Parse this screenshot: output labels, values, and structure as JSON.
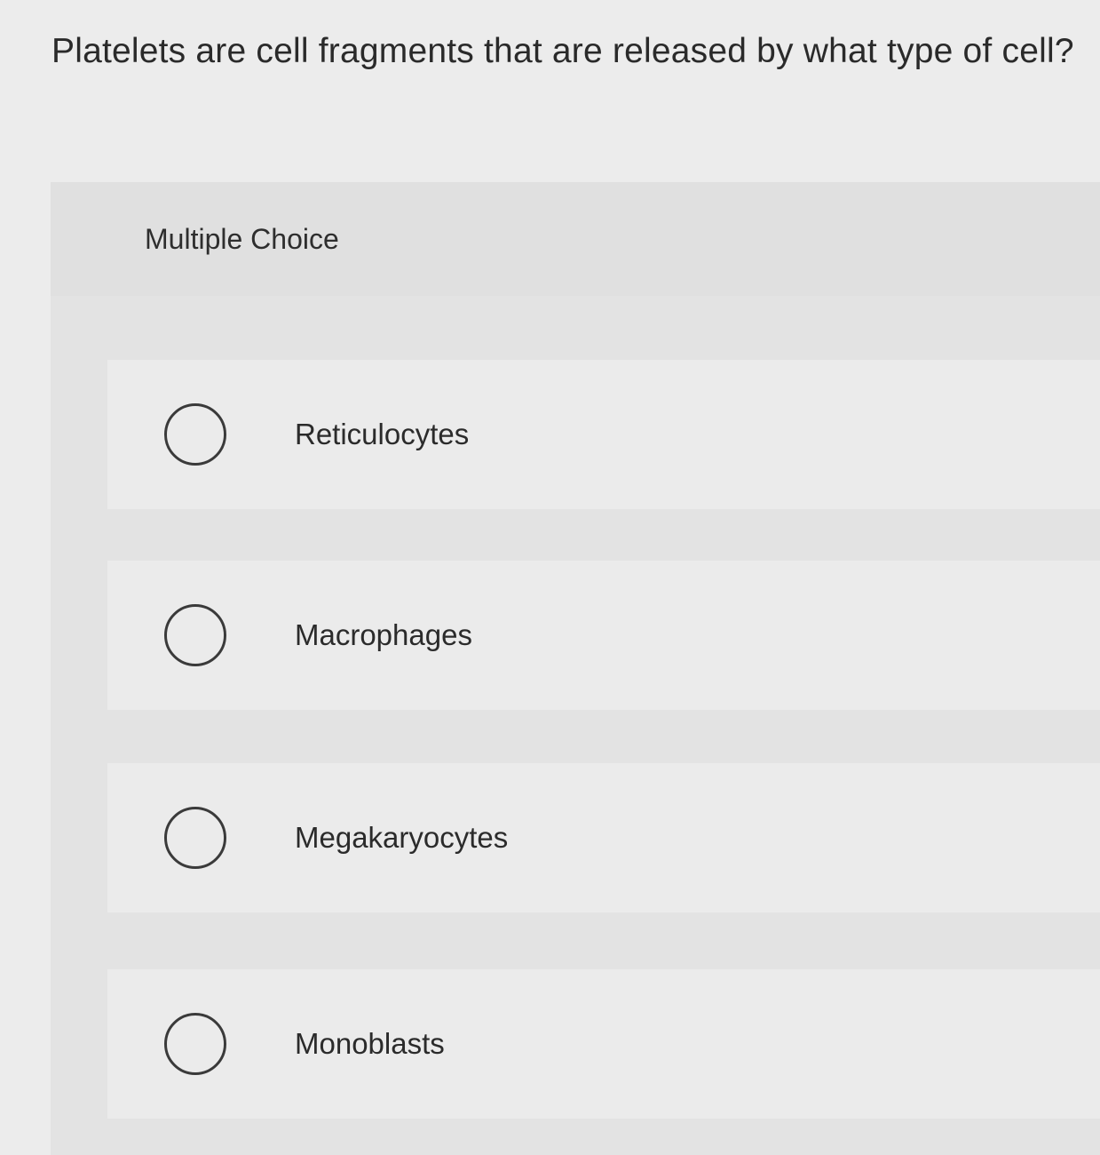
{
  "question": {
    "text": "Platelets are cell fragments that are released by what type of cell?"
  },
  "multiple_choice": {
    "label": "Multiple Choice",
    "options": [
      {
        "label": "Reticulocytes",
        "selected": false
      },
      {
        "label": "Macrophages",
        "selected": false
      },
      {
        "label": "Megakaryocytes",
        "selected": false
      },
      {
        "label": "Monoblasts",
        "selected": false
      }
    ]
  },
  "colors": {
    "page_background": "#ececec",
    "panel_background": "#e3e3e3",
    "option_background": "#ebebeb",
    "text": "#2b2b2b"
  }
}
